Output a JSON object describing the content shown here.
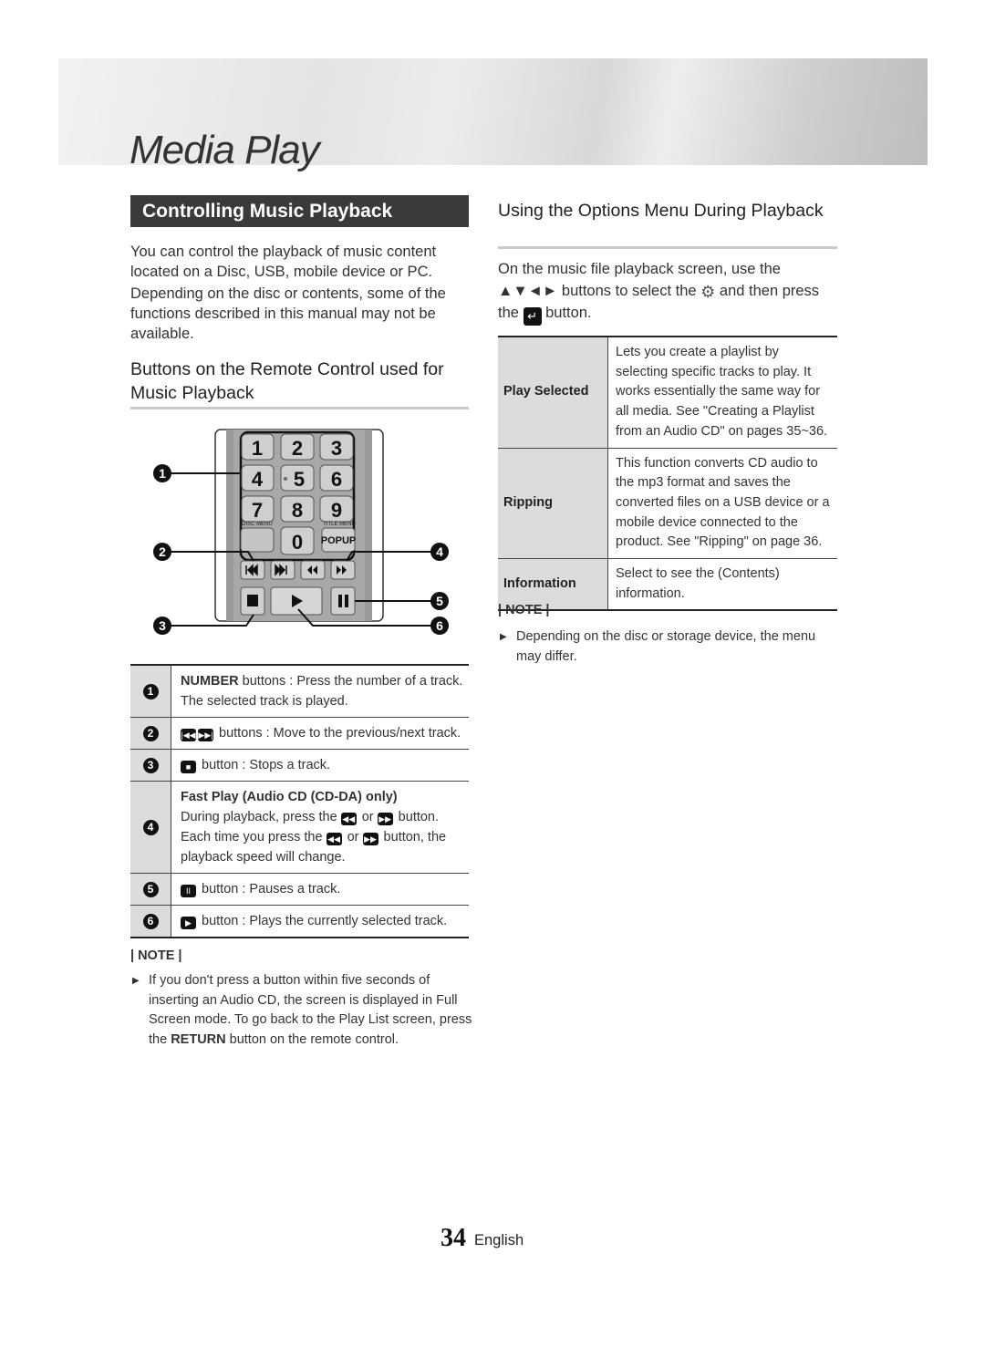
{
  "page": {
    "chapter_title": "Media Play",
    "page_number": "34",
    "language": "English"
  },
  "left": {
    "section_title": "Controlling Music Playback",
    "intro_1": "You can control the playback of music content located on a Disc, USB, mobile device or PC.",
    "intro_2": "Depending on the disc or contents, some of the functions described in this manual may not be available.",
    "subheading": "Buttons on the Remote Control used for Music Playback",
    "remote": {
      "keys": [
        "1",
        "2",
        "3",
        "4",
        "5",
        "6",
        "7",
        "8",
        "9",
        "0"
      ],
      "disc_menu": "DISC MENU",
      "title_menu": "TITLE MENU",
      "popup": "POPUP",
      "callouts": [
        "1",
        "2",
        "3",
        "4",
        "5",
        "6"
      ]
    },
    "button_table": [
      {
        "num": "1",
        "bold": "NUMBER",
        "text": " buttons : Press the number of a track. The selected track is played."
      },
      {
        "num": "2",
        "icons": [
          "prev-track-icon",
          "next-track-icon"
        ],
        "text": " buttons : Move to the previous/next track."
      },
      {
        "num": "3",
        "icons": [
          "stop-icon"
        ],
        "text": " button : Stops a track."
      },
      {
        "num": "4",
        "heading": "Fast Play (Audio CD (CD-DA) only)",
        "line1_a": "During playback, press the ",
        "line1_or": " or ",
        "line1_b": " button.",
        "line2_a": "Each time you press the ",
        "line2_or": " or ",
        "line2_b": " button, the playback speed will change."
      },
      {
        "num": "5",
        "icons": [
          "pause-icon"
        ],
        "text": " button : Pauses a track."
      },
      {
        "num": "6",
        "icons": [
          "play-icon"
        ],
        "text": " button : Plays the currently selected track."
      }
    ],
    "note_label": "| NOTE |",
    "note_a": "If you don't press a button within five seconds of inserting an Audio CD, the screen is displayed in Full Screen mode. To go back to the Play List screen, press the ",
    "note_bold": "RETURN",
    "note_b": " button on the remote control."
  },
  "right": {
    "heading": "Using the Options Menu During Playback",
    "intro_a": "On the music file playback screen, use the ▲▼◄► buttons to select the ",
    "intro_b": " and then press the ",
    "intro_c": " button.",
    "options": [
      {
        "label": "Play Selected",
        "desc": "Lets you create a playlist by selecting specific tracks to play. It works essentially the same way for all media. See \"Creating a Playlist from an Audio CD\" on pages 35~36."
      },
      {
        "label": "Ripping",
        "desc": "This function converts CD audio to the mp3 format and saves the converted files on a USB device or a mobile device connected to the product. See \"Ripping\" on page 36."
      },
      {
        "label": "Information",
        "desc": "Select to see the (Contents) information."
      }
    ],
    "note_label": "| NOTE |",
    "note": "Depending on the disc or storage device, the menu may differ."
  }
}
